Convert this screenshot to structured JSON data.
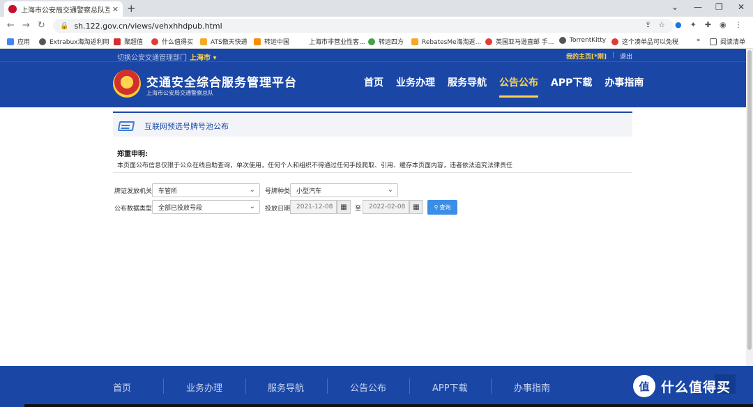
{
  "browser": {
    "tab_title": "上海市公安局交通警察总队互联网",
    "tab_close": "✕",
    "new_tab": "+",
    "url": "sh.122.gov.cn/views/vehxhhdpub.html",
    "bookmarks": [
      "应用",
      "Extrabux海淘返利网",
      "聚超值",
      "什么值得买",
      "ATS傲天快递",
      "转运中国",
      "上海市非营业性客...",
      "转运四方",
      "RebatesMe海淘返...",
      "英国亚马逊直邮 手...",
      "TorrentKitty",
      "这个凑单品可以免税",
      "»",
      "阅读清单"
    ]
  },
  "header": {
    "switch_label": "切换公安交通管理部门",
    "city": "上海市 ▾",
    "my_home": "我的主页[*刚]",
    "logout": "退出",
    "title": "交通安全综合服务管理平台",
    "subtitle": "上海市公安局交通警察总队",
    "nav": [
      "首页",
      "业务办理",
      "服务导航",
      "公告公布",
      "APP下载",
      "办事指南"
    ]
  },
  "panel": {
    "title": "互联网预选号牌号池公布",
    "notice_title": "郑重申明:",
    "notice_text": "本页面公布信息仅限于公众在线自助查询，单次使用，任何个人和组织不得通过任何手段爬取、引用、缓存本页面内容，违者依法追究法律责任"
  },
  "form": {
    "issuer_label": "牌证发放机关",
    "issuer_value": "车管所",
    "plate_type_label": "号牌种类",
    "plate_type_value": "小型汽车",
    "data_type_label": "公布数据类型",
    "data_type_value": "全部已投放号段",
    "date_label": "投放日期",
    "date_from": "2021-12-08",
    "date_to_label": "至",
    "date_to": "2022-02-08",
    "query_label": "查询"
  },
  "footer": {
    "items": [
      "首页",
      "业务办理",
      "服务导航",
      "公告公布",
      "APP下载",
      "办事指南"
    ],
    "watermark_logo": "值",
    "watermark_text": "什么值得买"
  }
}
